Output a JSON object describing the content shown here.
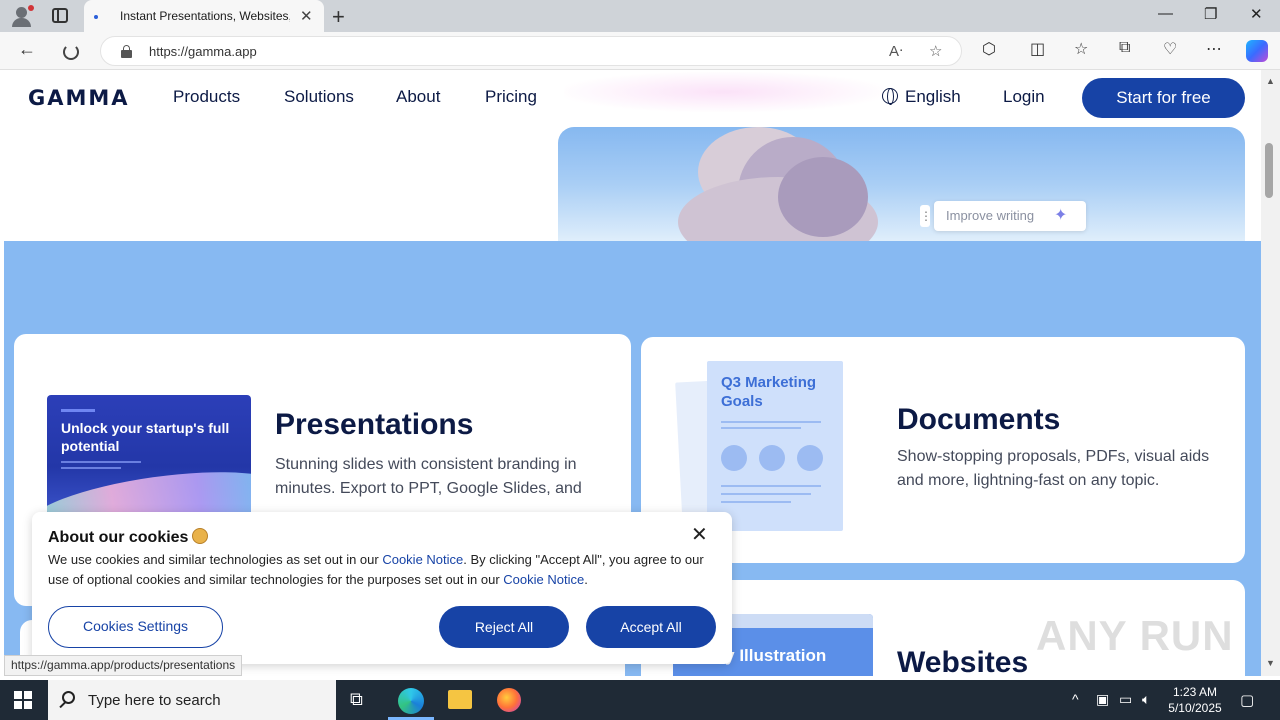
{
  "browser": {
    "tab_title": "Instant Presentations, Websites, a",
    "url": "https://gamma.app",
    "status_url": "https://gamma.app/products/presentations"
  },
  "header": {
    "logo": "GAMMA",
    "nav": [
      "Products",
      "Solutions",
      "About",
      "Pricing"
    ],
    "language": "English",
    "login": "Login",
    "cta": "Start for free"
  },
  "hero": {
    "improve_label": "Improve writing"
  },
  "cards": {
    "presentations": {
      "title": "Presentations",
      "description": "Stunning slides with consistent branding in minutes. Export to PPT, Google Slides, and",
      "thumb_text": "Unlock your startup's full potential"
    },
    "documents": {
      "title": "Documents",
      "description": "Show-stopping proposals, PDFs, visual aids and more, lightning-fast on any topic.",
      "thumb_text": "Q3 Marketing Goals"
    },
    "websites": {
      "title": "Websites",
      "thumb_text": "My Illustration"
    }
  },
  "cookie": {
    "title": "About our cookies",
    "text_1": "We use cookies and similar technologies as set out in our ",
    "link_1": "Cookie Notice",
    "text_2": ". By clicking \"Accept All\", you agree to our use of optional cookies and similar technologies for the purposes set out in our ",
    "link_2": "Cookie Notice",
    "text_3": ".",
    "settings": "Cookies Settings",
    "reject": "Reject All",
    "accept": "Accept All"
  },
  "watermark": "ANY RUN",
  "taskbar": {
    "search_placeholder": "Type here to search",
    "time": "1:23 AM",
    "date": "5/10/2025"
  },
  "colors": {
    "brand_navy": "#0c1a45",
    "primary_button": "#1743a6",
    "section_blue": "#87b9f2"
  }
}
